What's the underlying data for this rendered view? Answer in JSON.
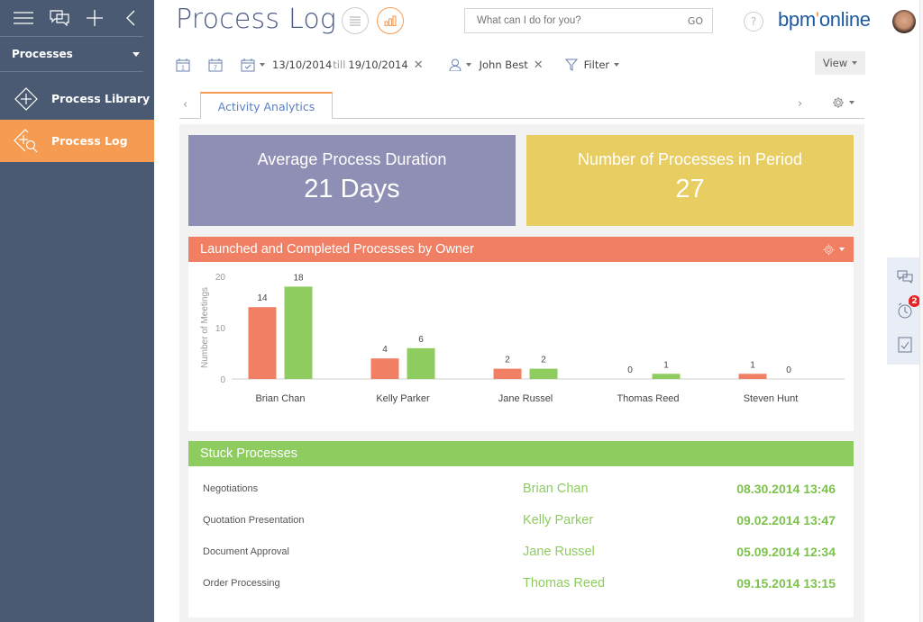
{
  "sidebar": {
    "top_icons": [
      "menu-icon",
      "chat-icon",
      "add-icon",
      "collapse-icon"
    ],
    "section": {
      "label": "Processes"
    },
    "items": [
      {
        "label": "Process Library",
        "icon": "process-library-icon",
        "active": false
      },
      {
        "label": "Process Log",
        "icon": "process-log-icon",
        "active": true
      }
    ]
  },
  "header": {
    "title": "Process Log",
    "view_modes": [
      "list-view",
      "analytics-view"
    ],
    "search": {
      "placeholder": "What can I do for you?",
      "value": "",
      "go_label": "GO"
    },
    "help_label": "?",
    "logo": {
      "part1": "bpm",
      "dot": "'",
      "part2": "online"
    }
  },
  "filters": {
    "date_from": "13/10/2014",
    "till_label": "till",
    "date_to": "19/10/2014",
    "owner": "John Best",
    "filter_label": "Filter",
    "view_label": "View"
  },
  "tabs": {
    "items": [
      {
        "label": "Activity Analytics",
        "active": true
      }
    ]
  },
  "kpis": [
    {
      "label": "Average Process Duration",
      "value": "21 Days",
      "color": "#8f8fb6"
    },
    {
      "label": "Number of Processes in Period",
      "value": "27",
      "color": "#e8cd63"
    }
  ],
  "chart_card": {
    "title": "Launched and Completed Processes by Owner"
  },
  "chart_data": {
    "type": "bar",
    "title": "Launched and Completed Processes by Owner",
    "xlabel": "",
    "ylabel": "Number of Meetings",
    "ylim": [
      0,
      20
    ],
    "yticks": [
      0,
      10,
      20
    ],
    "categories": [
      "Brian Chan",
      "Kelly Parker",
      "Jane Russel",
      "Thomas Reed",
      "Steven Hunt"
    ],
    "series": [
      {
        "name": "Launched",
        "color": "#f07f63",
        "values": [
          14,
          4,
          2,
          0,
          1
        ]
      },
      {
        "name": "Completed",
        "color": "#8fcc60",
        "values": [
          18,
          6,
          2,
          1,
          0
        ]
      }
    ],
    "grid": false,
    "legend": "none"
  },
  "stuck": {
    "title": "Stuck Processes",
    "rows": [
      {
        "process": "Negotiations",
        "owner": "Brian Chan",
        "date": "08.30.2014 13:46"
      },
      {
        "process": "Quotation Presentation",
        "owner": "Kelly Parker",
        "date": "09.02.2014 13:47"
      },
      {
        "process": "Document Approval",
        "owner": "Jane Russel",
        "date": "05.09.2014 12:34"
      },
      {
        "process": "Order Processing",
        "owner": "Thomas Reed",
        "date": "09.15.2014 13:15"
      }
    ]
  },
  "rightbar": {
    "icons": [
      "chat-icon",
      "reminder-icon",
      "task-icon"
    ],
    "reminder_badge": "2"
  }
}
